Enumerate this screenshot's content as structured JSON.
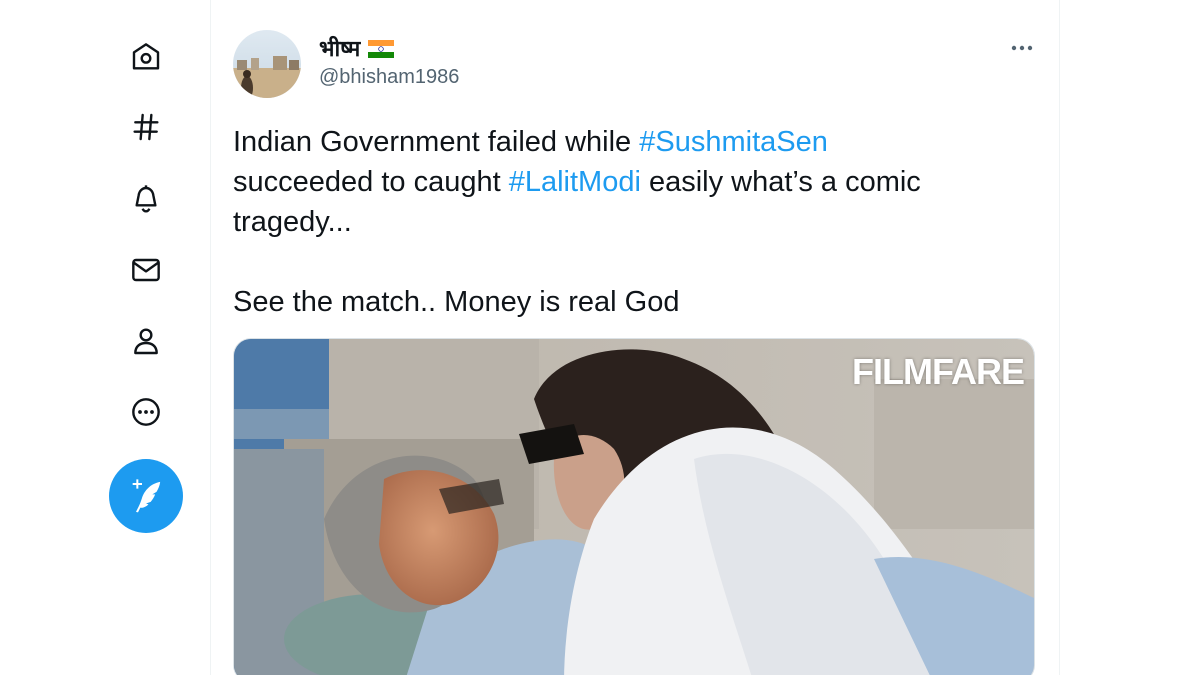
{
  "colors": {
    "accent": "#1d9bf0",
    "text_primary": "#0f1419",
    "text_secondary": "#536471",
    "border": "#eff3f4"
  },
  "sidebar": {
    "items": [
      {
        "icon": "home-icon"
      },
      {
        "icon": "hashtag-icon"
      },
      {
        "icon": "bell-icon"
      },
      {
        "icon": "mail-icon"
      },
      {
        "icon": "profile-icon"
      },
      {
        "icon": "more-circle-icon"
      }
    ],
    "compose": {
      "icon": "compose-quill-icon"
    }
  },
  "tweet": {
    "author": {
      "display_name": "भीष्म",
      "flag_icon": "india-flag-icon",
      "handle": "@bhisham1986"
    },
    "more_icon": "more-horizontal-icon",
    "text": {
      "l1_a": "Indian Government failed while ",
      "l1_tag": "#SushmitaSen",
      "l2_a": "succeeded to caught ",
      "l2_tag": "#LalitModi",
      "l2_b": " easily what’s a comic tragedy...",
      "l3": "See the match.. Money is real God"
    },
    "media": {
      "watermark": "FILMFARE"
    }
  }
}
